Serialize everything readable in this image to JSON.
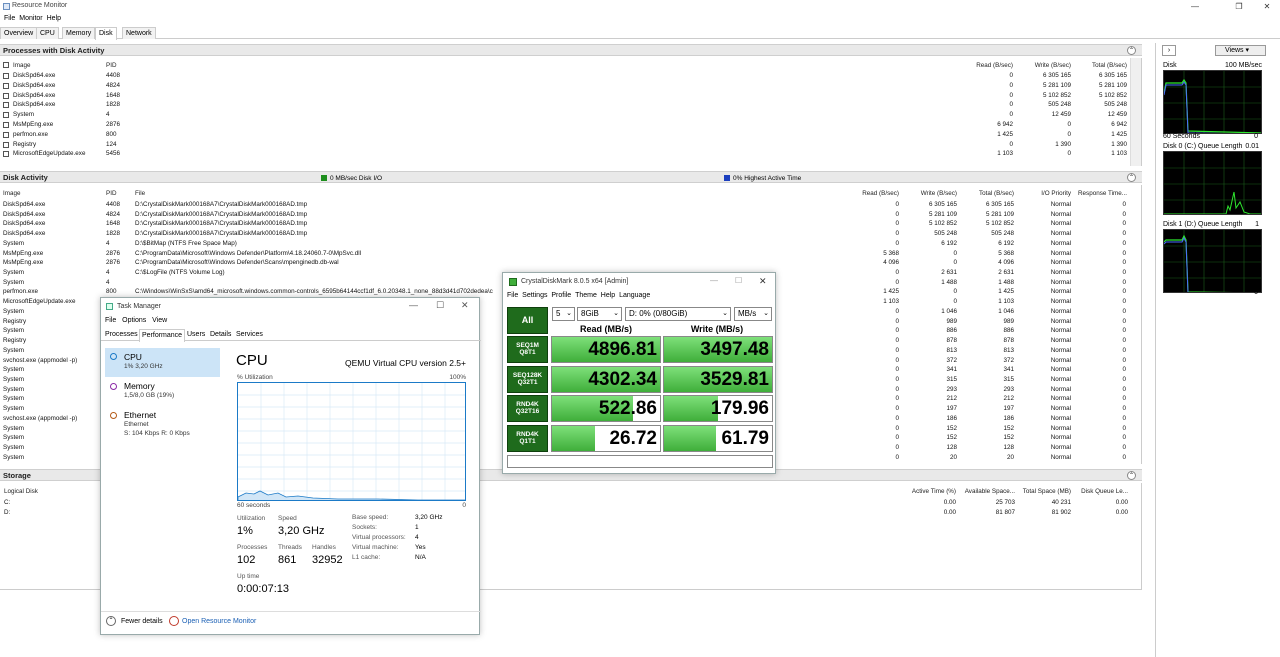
{
  "rm": {
    "title": "Resource Monitor",
    "menu": [
      "File",
      "Monitor",
      "Help"
    ],
    "tabs": [
      "Overview",
      "CPU",
      "Memory",
      "Disk",
      "Network"
    ],
    "processes": {
      "title": "Processes with Disk Activity",
      "headers": {
        "image": "Image",
        "pid": "PID",
        "read": "Read (B/sec)",
        "write": "Write (B/sec)",
        "total": "Total (B/sec)"
      },
      "rows": [
        [
          "DiskSpd64.exe",
          "4408",
          "0",
          "6 305 165",
          "6 305 165"
        ],
        [
          "DiskSpd64.exe",
          "4824",
          "0",
          "5 281 109",
          "5 281 109"
        ],
        [
          "DiskSpd64.exe",
          "1648",
          "0",
          "5 102 852",
          "5 102 852"
        ],
        [
          "DiskSpd64.exe",
          "1828",
          "0",
          "505 248",
          "505 248"
        ],
        [
          "System",
          "4",
          "0",
          "12 459",
          "12 459"
        ],
        [
          "MsMpEng.exe",
          "2876",
          "6 942",
          "0",
          "6 942"
        ],
        [
          "perfmon.exe",
          "800",
          "1 425",
          "0",
          "1 425"
        ],
        [
          "Registry",
          "124",
          "0",
          "1 390",
          "1 390"
        ],
        [
          "MicrosoftEdgeUpdate.exe",
          "5456",
          "1 103",
          "0",
          "1 103"
        ]
      ]
    },
    "disk_activity": {
      "title": "Disk Activity",
      "io_label": "0 MB/sec Disk I/O",
      "active_label": "0% Highest Active Time",
      "headers": {
        "image": "Image",
        "pid": "PID",
        "file": "File",
        "read": "Read (B/sec)",
        "write": "Write (B/sec)",
        "total": "Total (B/sec)",
        "prio": "I/O Priority",
        "resp": "Response Time..."
      },
      "rows": [
        [
          "DiskSpd64.exe",
          "4408",
          "D:\\CrystalDiskMark000168A7\\CrystalDiskMark000168AD.tmp",
          "0",
          "6 305 165",
          "6 305 165",
          "Normal",
          "0"
        ],
        [
          "DiskSpd64.exe",
          "4824",
          "D:\\CrystalDiskMark000168A7\\CrystalDiskMark000168AD.tmp",
          "0",
          "5 281 109",
          "5 281 109",
          "Normal",
          "0"
        ],
        [
          "DiskSpd64.exe",
          "1648",
          "D:\\CrystalDiskMark000168A7\\CrystalDiskMark000168AD.tmp",
          "0",
          "5 102 852",
          "5 102 852",
          "Normal",
          "0"
        ],
        [
          "DiskSpd64.exe",
          "1828",
          "D:\\CrystalDiskMark000168A7\\CrystalDiskMark000168AD.tmp",
          "0",
          "505 248",
          "505 248",
          "Normal",
          "0"
        ],
        [
          "System",
          "4",
          "D:\\$BitMap (NTFS Free Space Map)",
          "0",
          "6 192",
          "6 192",
          "Normal",
          "0"
        ],
        [
          "MsMpEng.exe",
          "2876",
          "C:\\ProgramData\\Microsoft\\Windows Defender\\Platform\\4.18.24060.7-0\\MpSvc.dll",
          "5 368",
          "0",
          "5 368",
          "Normal",
          "0"
        ],
        [
          "MsMpEng.exe",
          "2876",
          "C:\\ProgramData\\Microsoft\\Windows Defender\\Scans\\mpenginedb.db-wal",
          "4 096",
          "0",
          "4 096",
          "Normal",
          "0"
        ],
        [
          "System",
          "4",
          "C:\\$LogFile (NTFS Volume Log)",
          "0",
          "2 631",
          "2 631",
          "Normal",
          "0"
        ],
        [
          "System",
          "4",
          "",
          "0",
          "1 488",
          "1 488",
          "Normal",
          "0"
        ],
        [
          "perfmon.exe",
          "800",
          "C:\\Windows\\WinSxS\\amd64_microsoft.windows.common-controls_6595b64144ccf1df_6.0.20348.1_none_88d3d41d702dedea\\c",
          "1 425",
          "0",
          "1 425",
          "Normal",
          "0"
        ],
        [
          "MicrosoftEdgeUpdate.exe",
          "",
          "",
          "1 103",
          "0",
          "1 103",
          "Normal",
          "0"
        ],
        [
          "System",
          "",
          "",
          "0",
          "1 046",
          "1 046",
          "Normal",
          "0"
        ],
        [
          "Registry",
          "",
          "",
          "0",
          "989",
          "989",
          "Normal",
          "0"
        ],
        [
          "System",
          "",
          "",
          "0",
          "886",
          "886",
          "Normal",
          "0"
        ],
        [
          "Registry",
          "",
          "",
          "0",
          "878",
          "878",
          "Normal",
          "0"
        ],
        [
          "System",
          "",
          "",
          "0",
          "813",
          "813",
          "Normal",
          "0"
        ],
        [
          "svchost.exe (appmodel -p)",
          "",
          "",
          "0",
          "372",
          "372",
          "Normal",
          "0"
        ],
        [
          "System",
          "",
          "",
          "0",
          "341",
          "341",
          "Normal",
          "0"
        ],
        [
          "System",
          "",
          "",
          "0",
          "315",
          "315",
          "Normal",
          "0"
        ],
        [
          "System",
          "",
          "",
          "0",
          "293",
          "293",
          "Normal",
          "0"
        ],
        [
          "System",
          "",
          "",
          "0",
          "212",
          "212",
          "Normal",
          "0"
        ],
        [
          "System",
          "",
          "",
          "0",
          "197",
          "197",
          "Normal",
          "0"
        ],
        [
          "svchost.exe (appmodel -p)",
          "",
          "",
          "0",
          "186",
          "186",
          "Normal",
          "0"
        ],
        [
          "System",
          "",
          "",
          "0",
          "152",
          "152",
          "Normal",
          "0"
        ],
        [
          "System",
          "",
          "",
          "0",
          "152",
          "152",
          "Normal",
          "0"
        ],
        [
          "System",
          "",
          "",
          "0",
          "128",
          "128",
          "Normal",
          "0"
        ],
        [
          "System",
          "",
          "",
          "0",
          "20",
          "20",
          "Normal",
          "0"
        ]
      ]
    },
    "storage": {
      "title": "Storage",
      "headers": {
        "disk": "Logical Disk",
        "active": "Active Time (%)",
        "avail": "Available Space...",
        "total": "Total Space (MB)",
        "queue": "Disk Queue Le..."
      },
      "rows": [
        [
          "C:",
          "0.00",
          "25 703",
          "40 231",
          "0.00"
        ],
        [
          "D:",
          "0.00",
          "81 807",
          "81 902",
          "0.00"
        ]
      ]
    },
    "side": {
      "views": "Views",
      "disk_label": "Disk",
      "disk_scale": "100 MB/sec",
      "sixty": "60 Seconds",
      "zero": "0",
      "q0_label": "Disk 0 (C:) Queue Length",
      "q0_scale": "0.01",
      "q1_label": "Disk 1 (D:) Queue Length",
      "q1_scale": "1",
      "q1_zero": "0"
    }
  },
  "tm": {
    "title": "Task Manager",
    "menu": [
      "File",
      "Options",
      "View"
    ],
    "tabs": [
      "Processes",
      "Performance",
      "Users",
      "Details",
      "Services"
    ],
    "side": [
      {
        "name": "CPU",
        "sub": "1% 3,20 GHz",
        "sub2": ""
      },
      {
        "name": "Memory",
        "sub": "1,5/8,0 GB (19%)",
        "sub2": ""
      },
      {
        "name": "Ethernet",
        "sub": "Ethernet",
        "sub2": "S: 104 Kbps R: 0 Kbps"
      }
    ],
    "cpu_title": "CPU",
    "cpu_model": "QEMU Virtual CPU version 2.5+",
    "util_label": "% Utilization",
    "util_max": "100%",
    "sixty": "60 seconds",
    "zero": "0",
    "stats": {
      "utilization_label": "Utilization",
      "utilization": "1%",
      "speed_label": "Speed",
      "speed": "3,20 GHz",
      "processes_label": "Processes",
      "processes": "102",
      "threads_label": "Threads",
      "threads": "861",
      "handles_label": "Handles",
      "handles": "32952",
      "uptime_label": "Up time",
      "uptime": "0:00:07:13"
    },
    "details": [
      [
        "Base speed:",
        "3,20 GHz"
      ],
      [
        "Sockets:",
        "1"
      ],
      [
        "Virtual processors:",
        "4"
      ],
      [
        "Virtual machine:",
        "Yes"
      ],
      [
        "L1 cache:",
        "N/A"
      ]
    ],
    "fewer": "Fewer details",
    "open_rm": "Open Resource Monitor"
  },
  "cdm": {
    "title": "CrystalDiskMark 8.0.5 x64 [Admin]",
    "menu": [
      "File",
      "Settings",
      "Profile",
      "Theme",
      "Help",
      "Language"
    ],
    "all": "All",
    "count": "5",
    "size": "8GiB",
    "drive": "D: 0% (0/80GiB)",
    "unit": "MB/s",
    "read_header": "Read (MB/s)",
    "write_header": "Write (MB/s)",
    "tests": [
      {
        "l1": "SEQ1M",
        "l2": "Q8T1",
        "read": "4896.81",
        "write": "3497.48",
        "rf": 1.0,
        "wf": 1.0
      },
      {
        "l1": "SEQ128K",
        "l2": "Q32T1",
        "read": "4302.34",
        "write": "3529.81",
        "rf": 1.0,
        "wf": 1.0
      },
      {
        "l1": "RND4K",
        "l2": "Q32T16",
        "read": "522.86",
        "write": "179.96",
        "rf": 0.75,
        "wf": 0.5
      },
      {
        "l1": "RND4K",
        "l2": "Q1T1",
        "read": "26.72",
        "write": "61.79",
        "rf": 0.4,
        "wf": 0.48
      }
    ]
  },
  "colors": {
    "cdm_green": "#3fae3a",
    "rm_green": "#33cc33",
    "rm_blue": "#3366ff",
    "tm_blue": "#1b7ac7"
  }
}
